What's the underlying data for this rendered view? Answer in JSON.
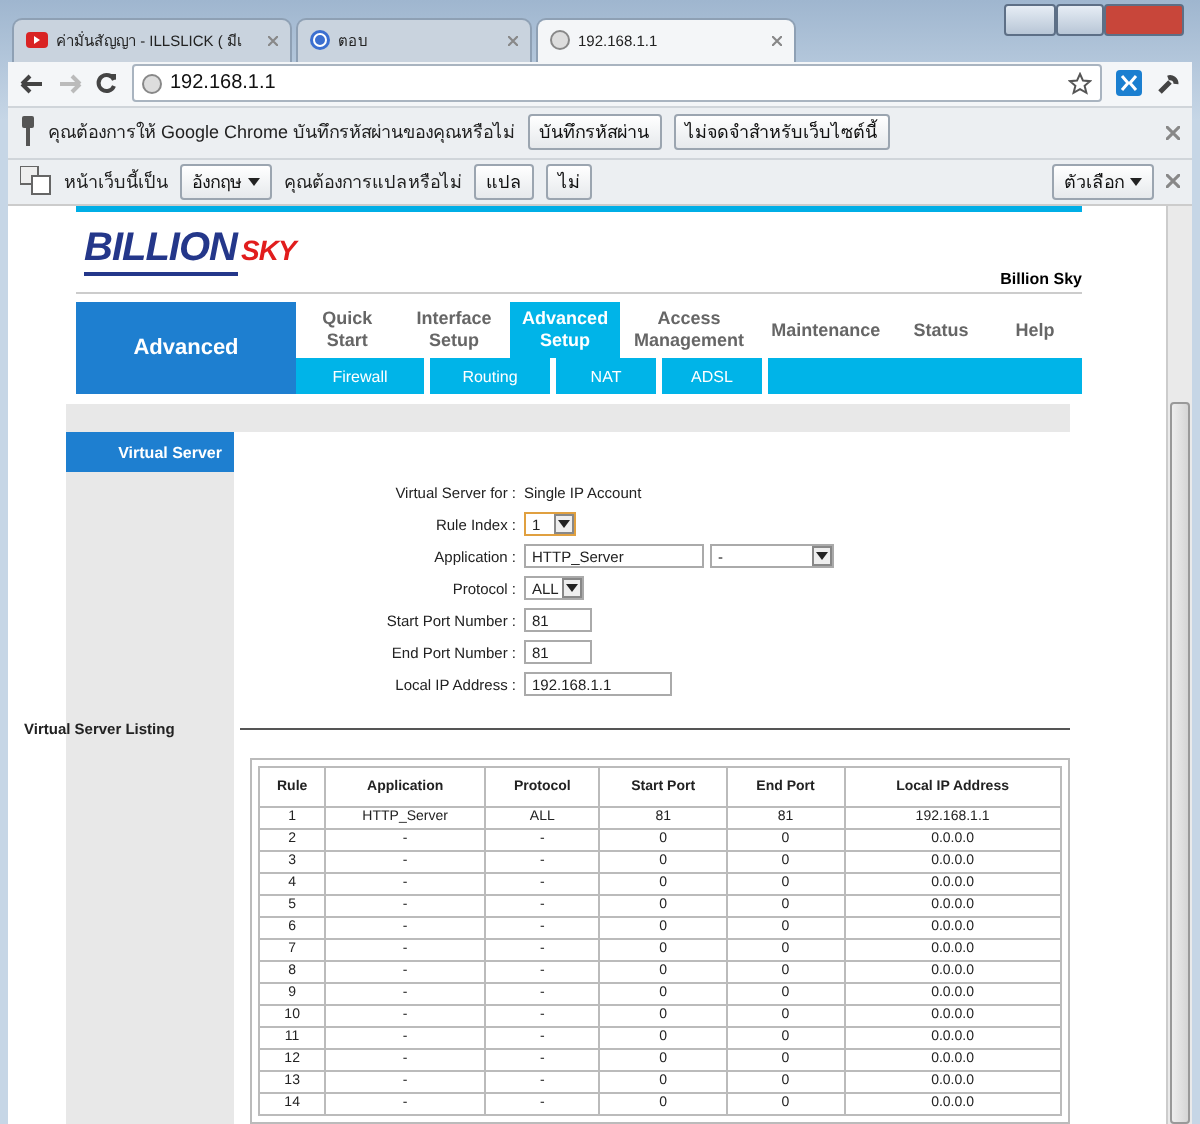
{
  "tabs": [
    {
      "title": "ค่ามั่นสัญญา - ILLSLICK ( มีเ",
      "selected": false
    },
    {
      "title": "ตอบ",
      "selected": false
    },
    {
      "title": "192.168.1.1",
      "selected": true
    }
  ],
  "address": "192.168.1.1",
  "password_bar": {
    "message": "คุณต้องการให้ Google Chrome บันทึกรหัสผ่านของคุณหรือไม่",
    "buttons": [
      "บันทึกรหัสผ่าน",
      "ไม่จดจำสำหรับเว็บไซต์นี้"
    ]
  },
  "translate_bar": {
    "prefix": "หน้าเว็บนี้เป็น",
    "language": "อังกฤษ",
    "question": "คุณต้องการแปลหรือไม่",
    "buttons": [
      "แปล",
      "ไม่"
    ],
    "options": "ตัวเลือก"
  },
  "router": {
    "logo": {
      "main": "BILLION",
      "accent": "SKY"
    },
    "device_name": "Billion Sky",
    "section": "Advanced",
    "nav": [
      {
        "label": "Quick\nStart",
        "selected": false
      },
      {
        "label": "Interface\nSetup",
        "selected": false
      },
      {
        "label": "Advanced\nSetup",
        "selected": true
      },
      {
        "label": "Access\nManagement",
        "selected": false
      },
      {
        "label": "Maintenance",
        "selected": false
      },
      {
        "label": "Status",
        "selected": false
      },
      {
        "label": "Help",
        "selected": false
      }
    ],
    "subnav": [
      "Firewall",
      "Routing",
      "NAT",
      "ADSL"
    ],
    "side_title": "Virtual Server",
    "form": [
      {
        "kind": "static",
        "label": "Virtual Server for :",
        "value": "Single IP Account"
      },
      {
        "kind": "select",
        "label": "Rule Index :",
        "value": "1",
        "focused": true
      },
      {
        "kind": "text_select",
        "label": "Application :",
        "value": "HTTP_Server",
        "option": "-"
      },
      {
        "kind": "select",
        "label": "Protocol :",
        "value": "ALL",
        "focused": false
      },
      {
        "kind": "text",
        "label": "Start Port Number :",
        "value": "81"
      },
      {
        "kind": "text",
        "label": "End Port Number :",
        "value": "81"
      },
      {
        "kind": "text",
        "label": "Local IP Address :",
        "value": "192.168.1.1"
      }
    ],
    "listing_title": "Virtual Server Listing",
    "table": {
      "columns": [
        "Rule",
        "Application",
        "Protocol",
        "Start Port",
        "End Port",
        "Local IP Address"
      ],
      "rows": [
        [
          "1",
          "HTTP_Server",
          "ALL",
          "81",
          "81",
          "192.168.1.1"
        ],
        [
          "2",
          "-",
          "-",
          "0",
          "0",
          "0.0.0.0"
        ],
        [
          "3",
          "-",
          "-",
          "0",
          "0",
          "0.0.0.0"
        ],
        [
          "4",
          "-",
          "-",
          "0",
          "0",
          "0.0.0.0"
        ],
        [
          "5",
          "-",
          "-",
          "0",
          "0",
          "0.0.0.0"
        ],
        [
          "6",
          "-",
          "-",
          "0",
          "0",
          "0.0.0.0"
        ],
        [
          "7",
          "-",
          "-",
          "0",
          "0",
          "0.0.0.0"
        ],
        [
          "8",
          "-",
          "-",
          "0",
          "0",
          "0.0.0.0"
        ],
        [
          "9",
          "-",
          "-",
          "0",
          "0",
          "0.0.0.0"
        ],
        [
          "10",
          "-",
          "-",
          "0",
          "0",
          "0.0.0.0"
        ],
        [
          "11",
          "-",
          "-",
          "0",
          "0",
          "0.0.0.0"
        ],
        [
          "12",
          "-",
          "-",
          "0",
          "0",
          "0.0.0.0"
        ],
        [
          "13",
          "-",
          "-",
          "0",
          "0",
          "0.0.0.0"
        ],
        [
          "14",
          "-",
          "-",
          "0",
          "0",
          "0.0.0.0"
        ]
      ]
    }
  }
}
